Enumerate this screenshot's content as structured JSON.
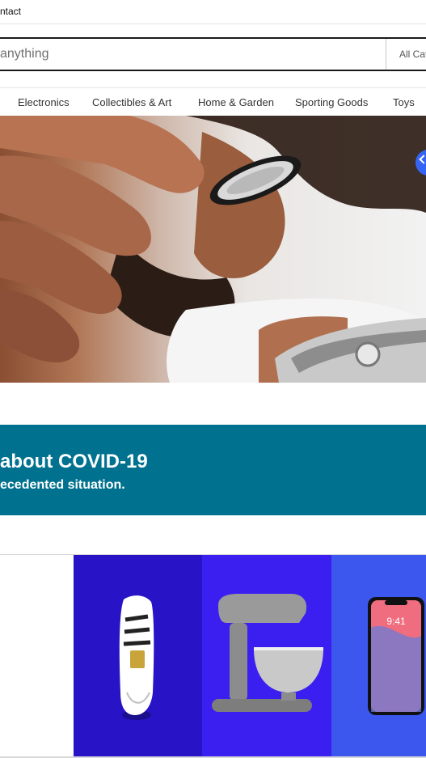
{
  "header": {
    "contact_label": "ntact"
  },
  "search": {
    "placeholder": "anything",
    "category_label": "All Categories"
  },
  "nav": {
    "items": [
      {
        "label": "Electronics"
      },
      {
        "label": "Collectibles & Art"
      },
      {
        "label": "Home & Garden"
      },
      {
        "label": "Sporting Goods"
      },
      {
        "label": "Toys"
      }
    ]
  },
  "banner": {
    "title": "about COVID-19",
    "subtitle": "ecedented situation."
  },
  "colors": {
    "accent": "#3665f3",
    "banner_bg": "#00728f",
    "tile_1": "#2813c6",
    "tile_2": "#3a1ff0",
    "tile_3": "#3b57ee"
  },
  "icons": {
    "hero_next": "chevron-right-icon",
    "shoe": "sneaker-icon",
    "mixer": "stand-mixer-icon",
    "phone": "smartphone-icon"
  },
  "phone_screen": {
    "time": "9:41"
  }
}
